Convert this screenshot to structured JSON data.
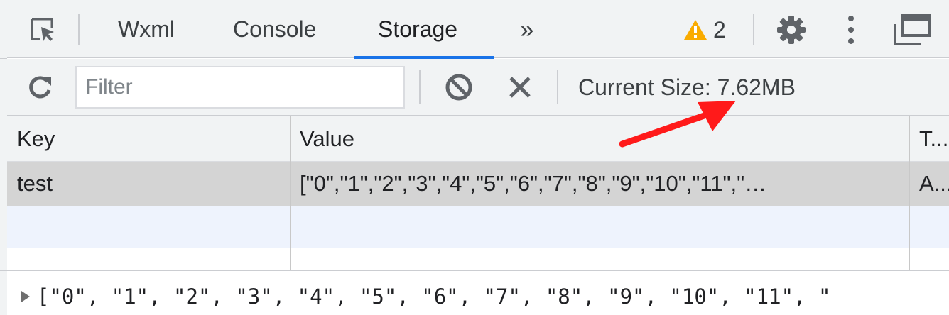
{
  "devtools": {
    "tabs": [
      {
        "label": "Wxml"
      },
      {
        "label": "Console"
      },
      {
        "label": "Storage"
      }
    ],
    "more_tabs_glyph": "»",
    "warning_count": "2",
    "colors": {
      "accent": "#1a73e8",
      "warning": "#f9ab00",
      "annotation_arrow": "#ff1a1a"
    }
  },
  "storage_toolbar": {
    "filter_placeholder": "Filter",
    "current_size": "Current Size: 7.62MB"
  },
  "table": {
    "columns": [
      "Key",
      "Value",
      "T..."
    ],
    "rows": [
      {
        "key": "test",
        "value": "[\"0\",\"1\",\"2\",\"3\",\"4\",\"5\",\"6\",\"7\",\"8\",\"9\",\"10\",\"11\",\"…",
        "type": "A..."
      }
    ]
  },
  "preview": {
    "text": "[\"0\", \"1\", \"2\", \"3\", \"4\", \"5\", \"6\", \"7\", \"8\", \"9\", \"10\", \"11\", \""
  }
}
